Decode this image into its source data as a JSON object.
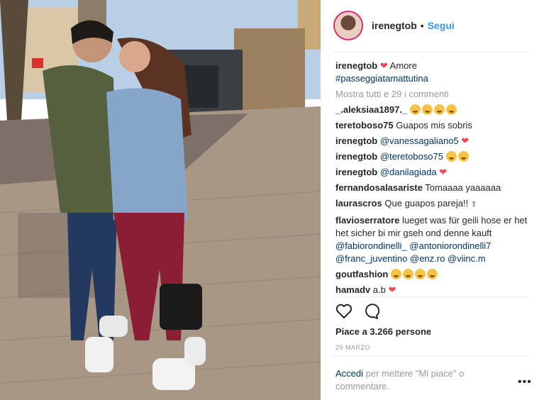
{
  "post": {
    "username": "irenegtob",
    "separator": "•",
    "follow_label": "Segui"
  },
  "comments": {
    "caption_user": "irenegtob",
    "caption_text": "Amore",
    "caption_tag": "#passeggiatamattutina",
    "show_all": "Mostra tutti e 29 i commenti",
    "items": [
      {
        "user": "_.aleksiaa1897._",
        "text": ""
      },
      {
        "user": "teretoboso75",
        "text": "Guapos mis sobris"
      },
      {
        "user": "irenegtob",
        "mention": "@vanessagaliano5"
      },
      {
        "user": "irenegtob",
        "mention": "@teretoboso75"
      },
      {
        "user": "irenegtob",
        "mention": "@danilagiada"
      },
      {
        "user": "fernandosalasariste",
        "text": "Tomaaaa yaaaaaa"
      },
      {
        "user": "laurascros",
        "text": "Que guapos pareja!!"
      },
      {
        "user": "flavioserratore",
        "text": "lueget was für geili hose er het het sicher bi mir gseh ond denne kauft",
        "mentions": [
          "@fabiorondinelli_",
          "@antoniorondinelli7",
          "@franc_juventino",
          "@enz.ro",
          "@viinc.m"
        ]
      },
      {
        "user": "goutfashion",
        "text": ""
      },
      {
        "user": "hamadv",
        "text": "a.b"
      }
    ]
  },
  "likes": "Piace a 3.266 persone",
  "date": "29 MARZO",
  "add_comment": {
    "login": "Accedi",
    "rest": "per mettere \"Mi piace\" o commentare."
  },
  "more_glyph": "•••",
  "icons": {
    "like": "heart-outline-icon",
    "comment": "comment-bubble-icon"
  },
  "colors": {
    "link": "#003569",
    "follow": "#3897f0",
    "heart": "#ed4956",
    "muted": "#999999"
  }
}
